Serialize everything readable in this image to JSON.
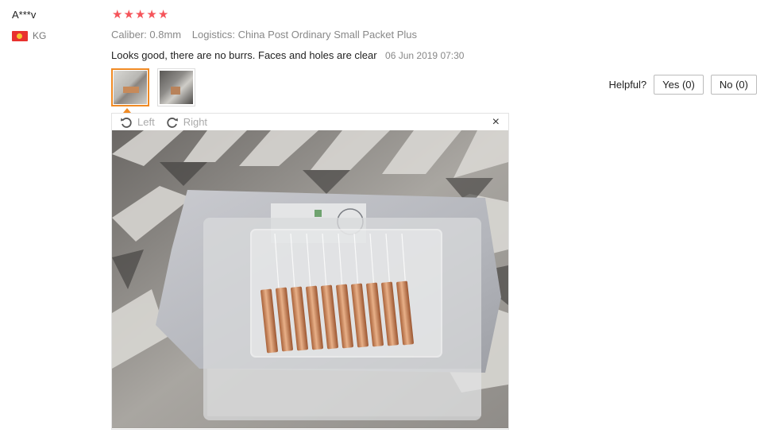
{
  "reviewer": {
    "name": "A***v",
    "country_code": "KG"
  },
  "rating": {
    "stars": 5,
    "max": 5
  },
  "attributes": {
    "caliber": "Caliber: 0.8mm",
    "logistics": "Logistics: China Post Ordinary Small Packet Plus"
  },
  "review": {
    "text": "Looks good, there are no burrs. Faces and holes are clear",
    "date": "06 Jun 2019 07:30"
  },
  "helpful": {
    "label": "Helpful?",
    "yes": "Yes (0)",
    "no": "No (0)"
  },
  "viewer": {
    "left_label": "Left",
    "right_label": "Right",
    "close": "×"
  },
  "colors": {
    "star": "#f5545a",
    "active_thumb": "#f08a24",
    "flag": "#e8322f"
  }
}
